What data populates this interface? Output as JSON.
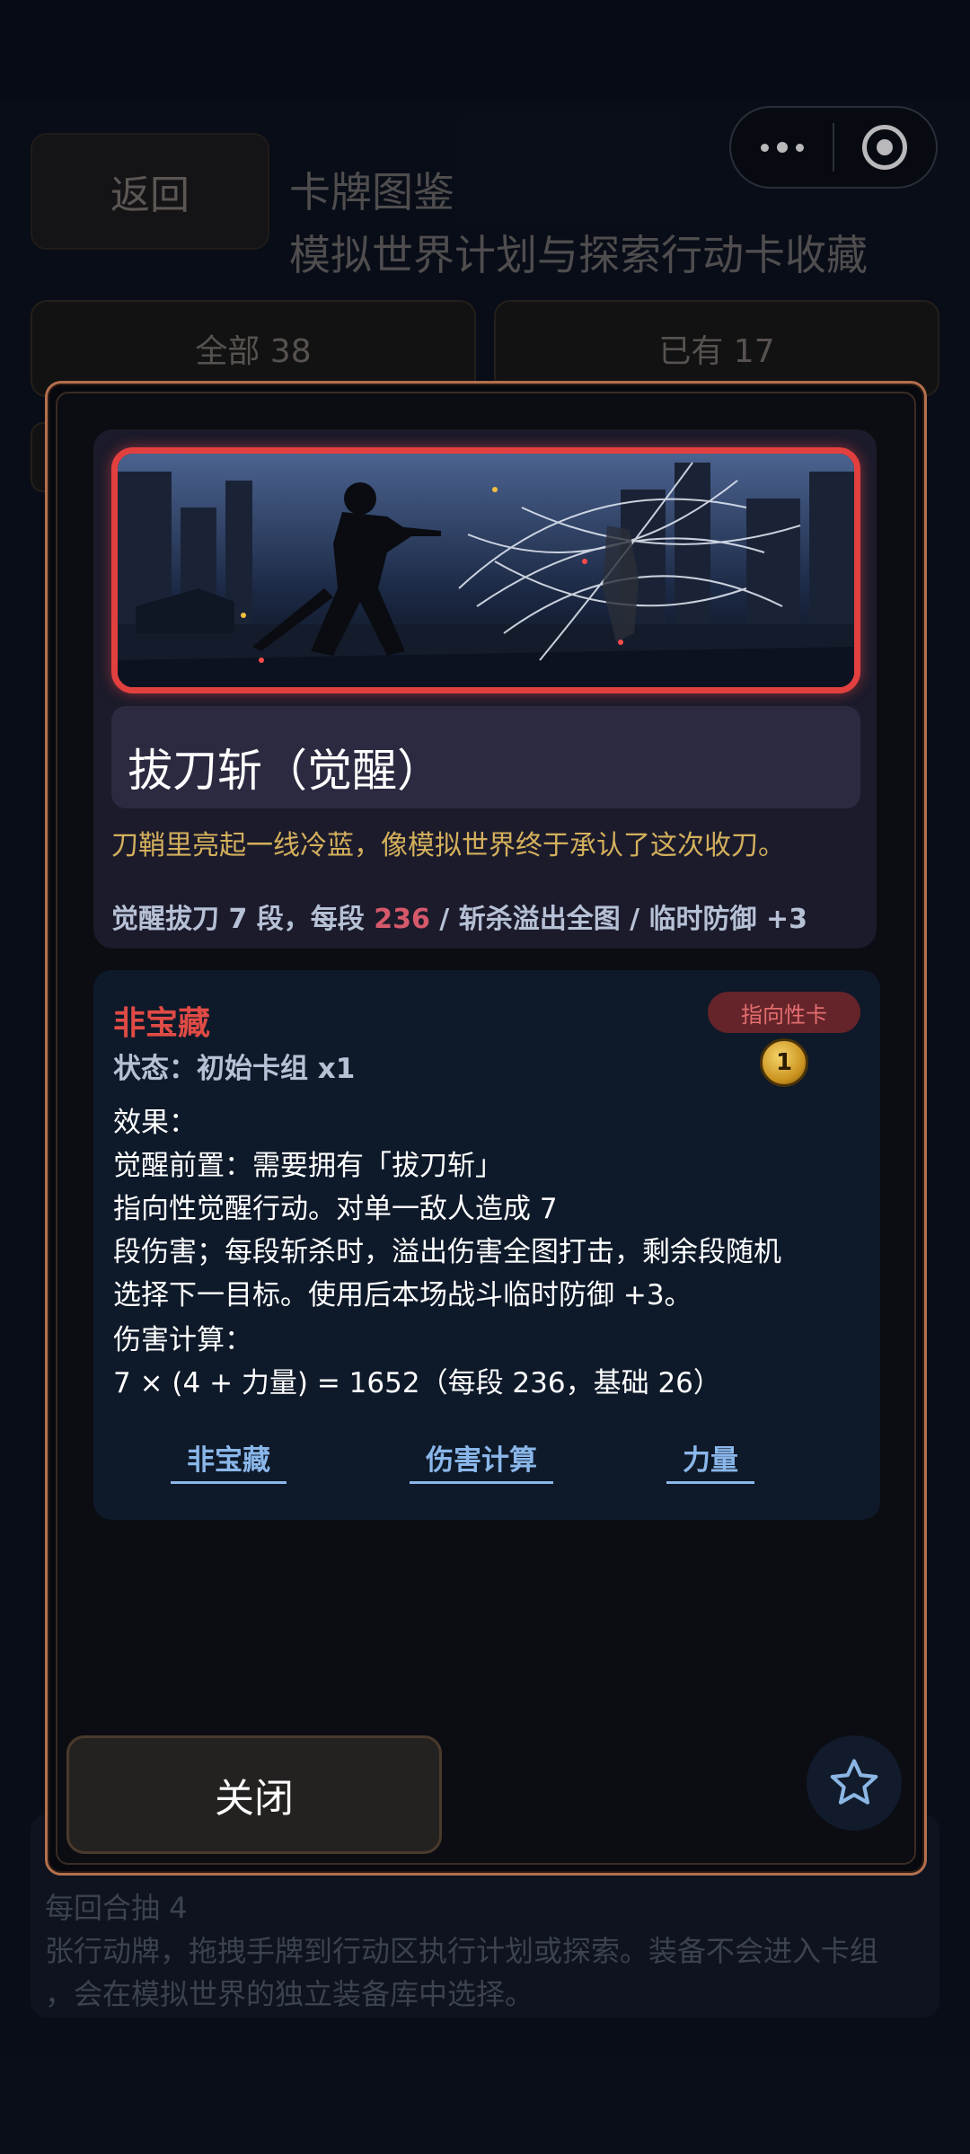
{
  "capsule": {
    "more_icon": "more-dots-icon",
    "close_icon": "target-circle-icon"
  },
  "header": {
    "back_label": "返回",
    "title": "卡牌图鉴",
    "subtitle": "模拟世界计划与探索行动卡收藏"
  },
  "filters": [
    {
      "label": "全部 38"
    },
    {
      "label": "已有 17"
    }
  ],
  "bottom_note": {
    "line1": "每回合抽 4",
    "line2": "张行动牌，拖拽手牌到行动区执行计划或探索。装备不会进入卡组",
    "line3": "，会在模拟世界的独立装备库中选择。"
  },
  "modal": {
    "card_name": "拔刀斩（觉醒）",
    "flavor": "刀鞘里亮起一线冷蓝，像模拟世界终于承认了这次收刀。",
    "summary": {
      "prefix": "觉醒拔刀 7 段，每段 ",
      "damage": "236",
      "suffix": " / 斩杀溢出全图 / 临时防御 +3"
    },
    "rarity": "非宝藏",
    "state": "状态：初始卡组 x1",
    "tag": "指向性卡",
    "cost": "1",
    "effect_lines": [
      "效果：",
      "觉醒前置：需要拥有「拔刀斩」",
      "指向性觉醒行动。对单一敌人造成 7",
      "段伤害；每段斩杀时，溢出伤害全图打击，剩余段随机",
      "选择下一目标。使用后本场战斗临时防御 +3。",
      "伤害计算：",
      "7 × (4 + 力量) = 1652（每段 236，基础 26）"
    ],
    "links": [
      "非宝藏",
      "伤害计算",
      "力量"
    ],
    "close_label": "关闭",
    "favorite_icon": "star-outline-icon"
  },
  "colors": {
    "accent_border": "#b4704e",
    "rarity_red": "#e04b45",
    "frame_red": "#e2403f",
    "link_blue": "#8ab7ea",
    "flavor_gold": "#d4b05c"
  }
}
